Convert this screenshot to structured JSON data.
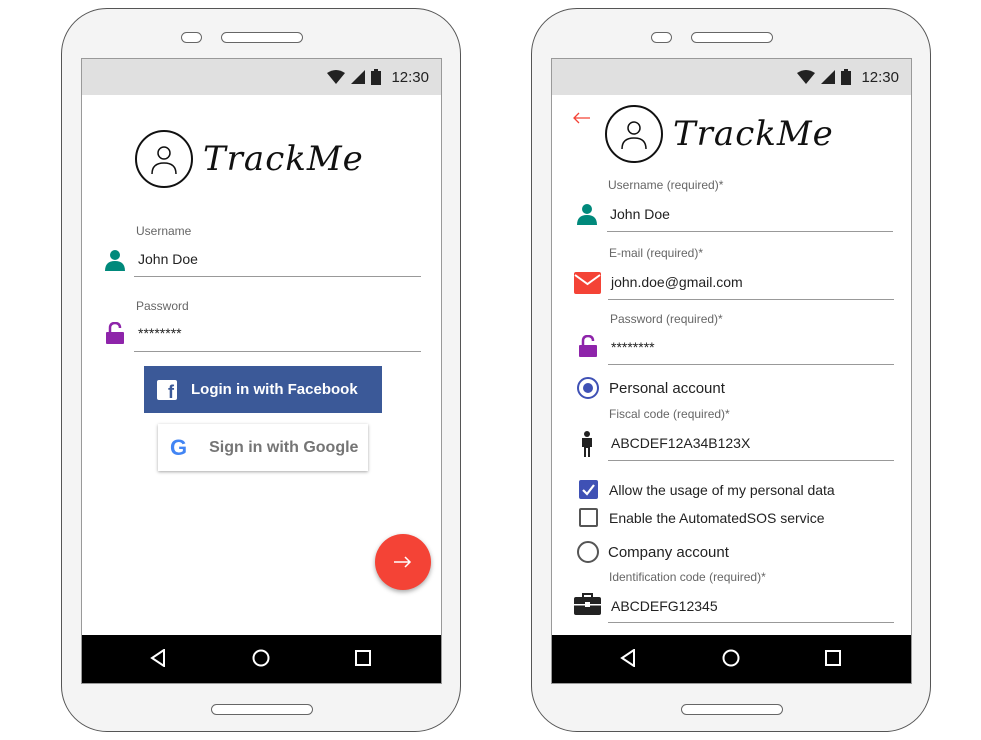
{
  "status": {
    "time": "12:30"
  },
  "app": {
    "name": "TrackMe"
  },
  "login": {
    "username_label": "Username",
    "username_value": "John Doe",
    "password_label": "Password",
    "password_value": "********",
    "facebook_label": "Login in with Facebook",
    "facebook_glyph": "f",
    "google_label": "Sign in with Google",
    "google_glyph": "G"
  },
  "register": {
    "username_label": "Username (required)*",
    "username_value": "John Doe",
    "email_label": "E-mail (required)*",
    "email_value": "john.doe@gmail.com",
    "password_label": "Password (required)*",
    "password_value": "********",
    "personal_label": "Personal account",
    "fiscal_label": "Fiscal code (required)*",
    "fiscal_value": "ABCDEF12A34B123X",
    "allow_label": "Allow the usage of my personal data",
    "sos_label": "Enable the AutomatedSOS service",
    "company_label": "Company account",
    "ident_label": "Identification code (required)*",
    "ident_value": "ABCDEFG12345"
  },
  "colors": {
    "user_icon": "#00897b",
    "lock_icon": "#8e24aa",
    "email_icon": "#f44336",
    "facebook": "#3b5998",
    "fab": "#f44336",
    "accent": "#3f51b5",
    "back_arrow": "#f44336"
  },
  "icons": [
    "wifi-icon",
    "signal-icon",
    "battery-icon",
    "back-triangle-icon",
    "home-circle-icon",
    "recents-square-icon",
    "user-icon",
    "lock-open-icon",
    "email-icon",
    "person-icon",
    "briefcase-icon",
    "arrow-right-icon",
    "arrow-left-icon"
  ]
}
